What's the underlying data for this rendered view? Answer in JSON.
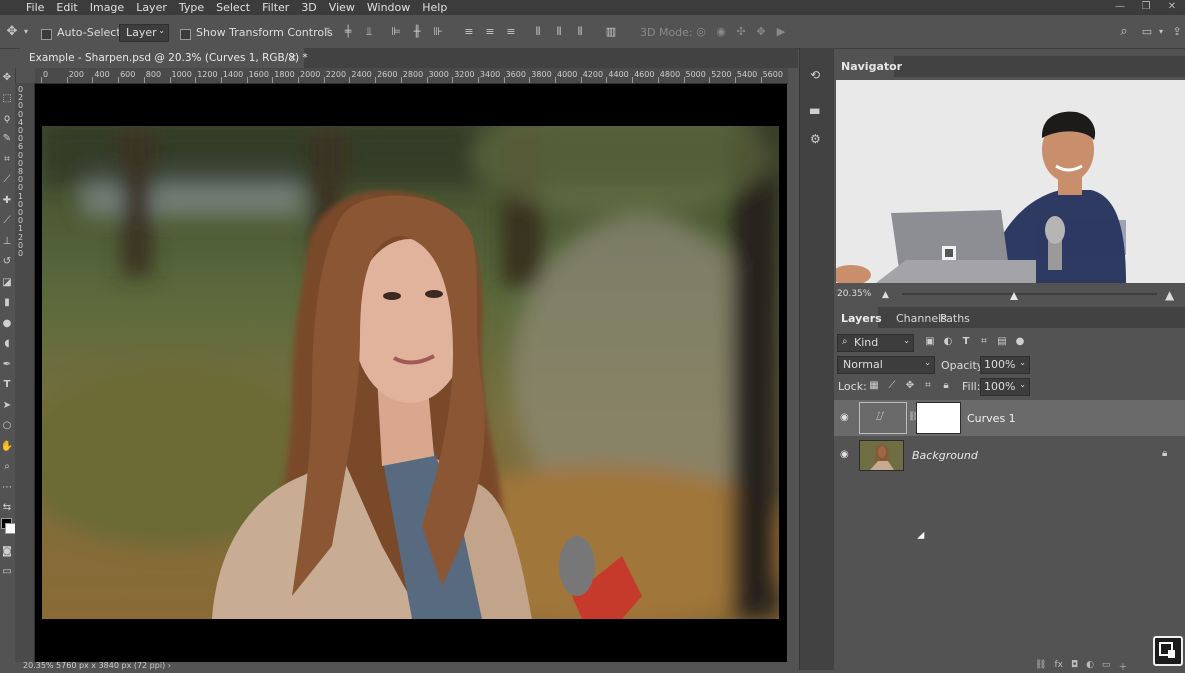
{
  "menu": [
    "File",
    "Edit",
    "Image",
    "Layer",
    "Type",
    "Select",
    "Filter",
    "3D",
    "View",
    "Window",
    "Help"
  ],
  "options": {
    "auto_select_label": "Auto-Select:",
    "auto_select_value": "Layer",
    "transform_label": "Show Transform Controls",
    "mode3d_label": "3D Mode:"
  },
  "document": {
    "tab_title": "Example - Sharpen.psd @ 20.3% (Curves 1, RGB/8) *",
    "close": "×",
    "status": "20.35%    5760 px x 3840 px (72 ppi)   ›"
  },
  "ruler": {
    "h_ticks": [
      "0",
      "200",
      "400",
      "600",
      "800",
      "1000",
      "1200",
      "1400",
      "1600",
      "1800",
      "2000",
      "2200",
      "2400",
      "2600",
      "2800",
      "3000",
      "3200",
      "3400",
      "3600",
      "3800",
      "4000",
      "4200",
      "4400",
      "4600",
      "4800",
      "5000",
      "5200",
      "5400",
      "5600"
    ],
    "v_ticks": [
      "0",
      "2",
      "0",
      "0",
      "4",
      "0",
      "0",
      "6",
      "0",
      "0",
      "8",
      "0",
      "0",
      "1",
      "0",
      "0",
      "0",
      "1",
      "2",
      "0",
      "0"
    ]
  },
  "navigator": {
    "title": "Navigator",
    "zoom": "20.35%",
    "zoom_fraction": 0.44
  },
  "layers_panel": {
    "tabs": [
      "Layers",
      "Channels",
      "Paths"
    ],
    "kind_label": "Kind",
    "blend_mode": "Normal",
    "opacity_label": "Opacity:",
    "opacity_value": "100%",
    "lock_label": "Lock:",
    "fill_label": "Fill:",
    "fill_value": "100%",
    "layers": [
      {
        "name": "Curves 1",
        "selected": true
      },
      {
        "name": "Background",
        "selected": false,
        "locked": true
      }
    ]
  },
  "colors": {
    "panel": "#535353",
    "panel_dark": "#424242",
    "selected_layer": "#6a6a6a"
  }
}
